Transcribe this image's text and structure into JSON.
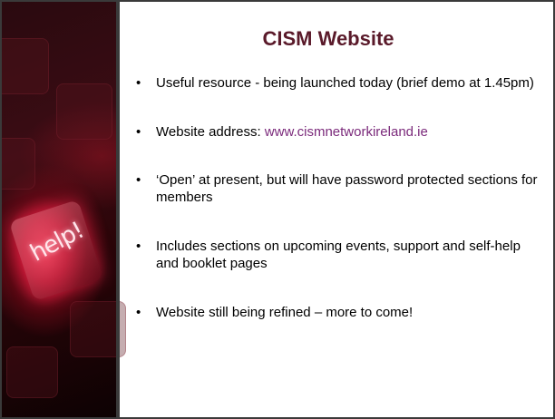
{
  "slide": {
    "title": "CISM Website",
    "image_caption": "help!",
    "bullets": [
      {
        "text": "Useful resource  - being launched today (brief demo at 1.45pm)"
      },
      {
        "prefix": "Website address: ",
        "link": "www.cismnetworkireland.ie"
      },
      {
        "text": "‘Open’ at present, but will have password protected sections for members"
      },
      {
        "text": "Includes sections on upcoming events, support and self-help and booklet pages"
      },
      {
        "text": "Website still being refined – more to come!"
      }
    ]
  },
  "colors": {
    "title": "#5a1a2a",
    "link": "#7b2a7b",
    "border": "#3a3a3a"
  }
}
